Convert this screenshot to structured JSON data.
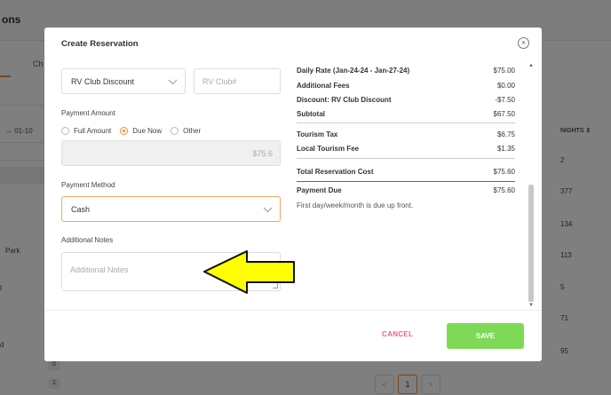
{
  "background": {
    "title": "ons",
    "tab": "Ch",
    "date": "01-10",
    "side_labels": [
      "Park",
      "t",
      "d"
    ],
    "side_badges": [
      "0",
      "1"
    ],
    "col_header": "NIGHTS",
    "col_values": [
      "2",
      "377",
      "134",
      "113",
      "5",
      "71",
      "95"
    ],
    "pager": {
      "prev": "<",
      "current": "1",
      "next": ">"
    }
  },
  "modal": {
    "title": "Create Reservation",
    "close_icon": "×",
    "discount_select": "RV Club Discount",
    "rv_club_placeholder": "RV Club#",
    "payment_amount_label": "Payment Amount",
    "payment_options": [
      "Full Amount",
      "Due Now",
      "Other"
    ],
    "selected_payment_option": "Due Now",
    "amount_value": "$75.6",
    "payment_method_label": "Payment Method",
    "payment_method_value": "Cash",
    "additional_notes_label": "Additional Notes",
    "additional_notes_placeholder": "Additional Notes",
    "summary": {
      "rows": [
        {
          "label": "Daily Rate (Jan-24-24 - Jan-27-24)",
          "value": "$75.00"
        },
        {
          "label": "Additional Fees",
          "value": "$0.00"
        },
        {
          "label": "Discount: RV Club Discount",
          "value": "-$7.50"
        },
        {
          "label": "Subtotal",
          "value": "$67.50"
        },
        {
          "label": "Tourism Tax",
          "value": "$6.75"
        },
        {
          "label": "Local Tourism Fee",
          "value": "$1.35"
        },
        {
          "label": "Total Reservation Cost",
          "value": "$75.60"
        },
        {
          "label": "Payment Due",
          "value": "$75.60"
        }
      ],
      "note": "First day/week/month is due up front."
    },
    "cancel_label": "CANCEL",
    "save_label": "SAVE"
  },
  "colors": {
    "accent": "#f58b2f",
    "save": "#7ed957",
    "cancel": "#e8658f",
    "arrow": "#ffff00"
  }
}
